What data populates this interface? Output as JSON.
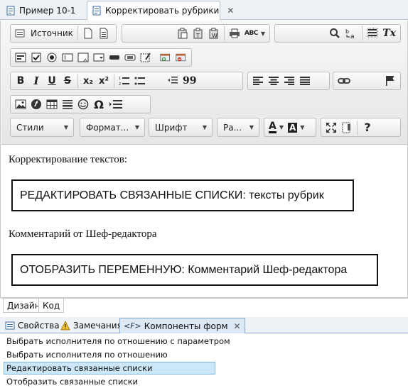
{
  "tabs": [
    {
      "label": "Пример 10-1",
      "icon": "form-doc-icon"
    },
    {
      "label": "Корректировать рубрики",
      "icon": "form-doc-icon",
      "close": "✕"
    }
  ],
  "toolbar": {
    "source_label": "Источник",
    "styles_label": "Стили",
    "format_label": "Формат...",
    "font_label": "Шрифт",
    "size_label": "Ра...",
    "bold": "B",
    "italic": "I",
    "underline": "U",
    "strike": "S",
    "subscript": "x₂",
    "superscript": "x²",
    "special_char": "Ω",
    "help": "?",
    "textcolor": "A",
    "bgcolor": "A",
    "quote": "99",
    "remove_format": "Tx",
    "spellcheck": "ABC"
  },
  "content": {
    "line1": "Корректирование текстов:",
    "box1": "РЕДАКТИРОВАТЬ СВЯЗАННЫЕ СПИСКИ: тексты рубрик",
    "line2": "Комментарий от Шеф-редактора",
    "box2": "ОТОБРАЗИТЬ ПЕРЕМЕННУЮ: Комментарий Шеф-редактора"
  },
  "mode_tabs": [
    "Дизайн",
    "Код"
  ],
  "panel": {
    "tabs": [
      {
        "label": "Свойства",
        "icon": "properties-icon"
      },
      {
        "label": "Замечания",
        "icon": "warning-icon"
      },
      {
        "label": "Компоненты форм",
        "icon": "form-components-icon",
        "close": "✕"
      }
    ],
    "items": [
      "Выбрать исполнителя по отношению с параметром",
      "Выбрать исполнителя по отношению",
      "Редактировать связанные списки",
      "Отобразить связанные списки"
    ],
    "selected_index": 2
  }
}
